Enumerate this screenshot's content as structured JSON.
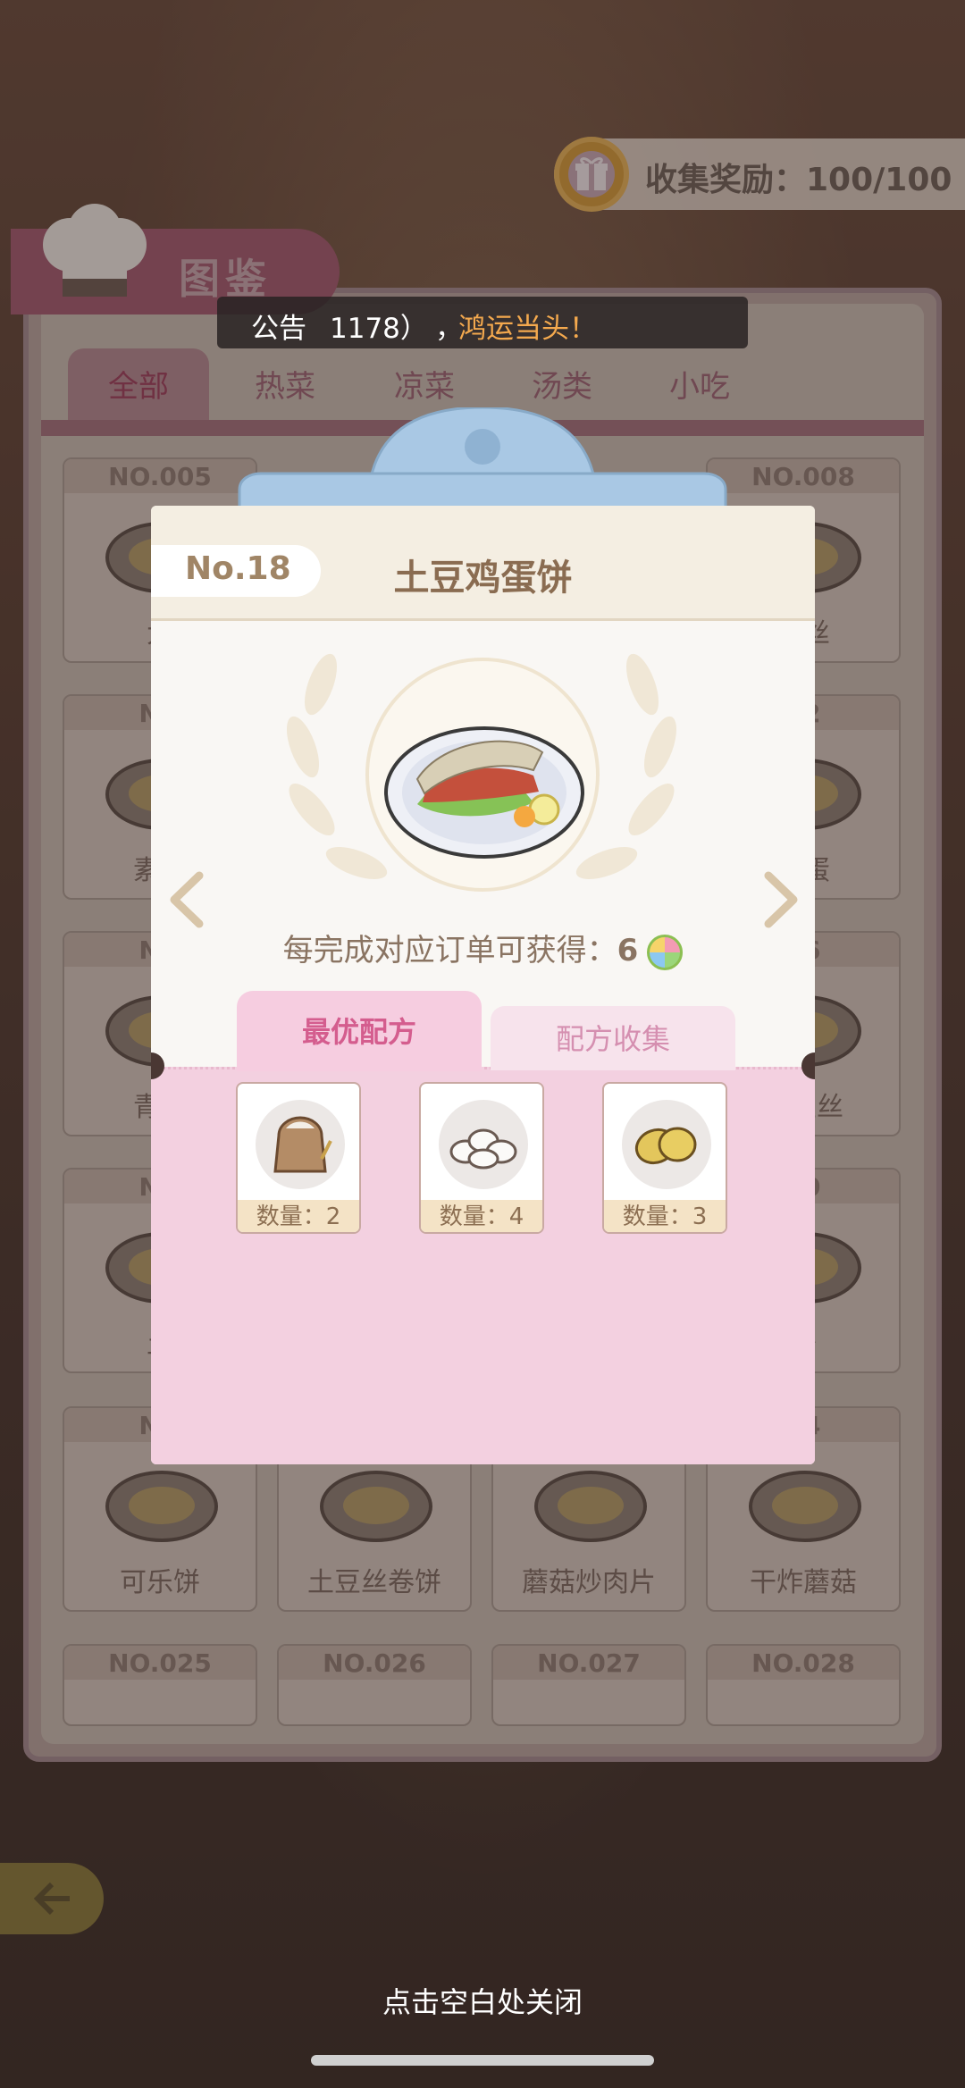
{
  "reward": {
    "label": "收集奖励：100/100",
    "icon": "gift-icon"
  },
  "catalog": {
    "title": "图鉴",
    "tabs": [
      "全部",
      "热菜",
      "凉菜",
      "汤类",
      "小吃"
    ],
    "grid": [
      {
        "no": "NO.005",
        "name": "大"
      },
      {
        "no": "NO.008",
        "name": "肉丝"
      },
      {
        "no": "NO",
        "name": "素炒"
      },
      {
        "no": "12",
        "name": "鸡蛋"
      },
      {
        "no": "NO",
        "name": "青椒"
      },
      {
        "no": "16",
        "name": "土豆丝"
      },
      {
        "no": "NO",
        "name": "土"
      },
      {
        "no": "20",
        "name": "条"
      },
      {
        "no": "NO",
        "name": "可乐饼"
      },
      {
        "no": "",
        "name": "土豆丝卷饼"
      },
      {
        "no": "",
        "name": "蘑菇炒肉片"
      },
      {
        "no": "24",
        "name": "干炸蘑菇"
      },
      {
        "no": "NO.025",
        "name": ""
      },
      {
        "no": "NO.026",
        "name": ""
      },
      {
        "no": "NO.027",
        "name": ""
      },
      {
        "no": "NO.028",
        "name": ""
      }
    ]
  },
  "notice": {
    "label": "公告",
    "id": "1178）",
    "sep": "，",
    "highlight": "鸿运当头！"
  },
  "modal": {
    "number": "No.18",
    "dish_name": "土豆鸡蛋饼",
    "reward_text": "每完成对应订单可获得：",
    "reward_value": "6",
    "tabs": {
      "best": "最优配方",
      "collect": "配方收集"
    },
    "ingredients": [
      {
        "name": "flour",
        "qty": "数量：2"
      },
      {
        "name": "eggs",
        "qty": "数量：4"
      },
      {
        "name": "potatoes",
        "qty": "数量：3"
      }
    ]
  },
  "close_hint": "点击空白处关闭",
  "colors": {
    "accent_pink": "#d45d8e",
    "brand_brown": "#8a6c51",
    "notice_orange": "#f4a94e"
  }
}
